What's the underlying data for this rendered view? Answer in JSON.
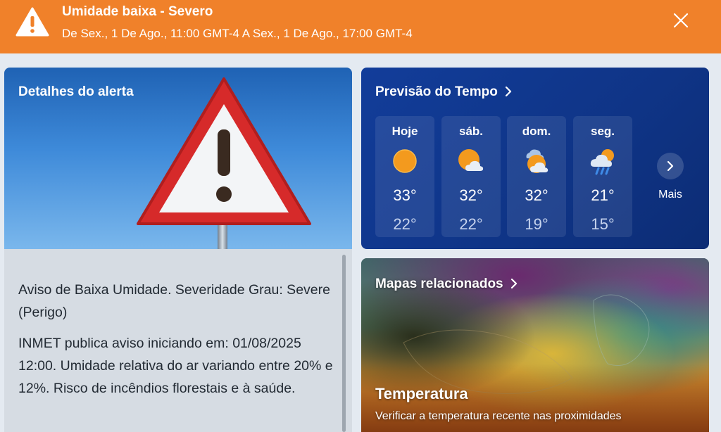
{
  "banner": {
    "title": "Umidade baixa - Severo",
    "period": "De Sex., 1 De Ago., 11:00 GMT-4 A Sex., 1 De Ago., 17:00 GMT-4",
    "icon": "warning-triangle-icon",
    "close_icon": "close-icon",
    "color": "#f0812a"
  },
  "details": {
    "title": "Detalhes do alerta",
    "paragraphs": [
      "Aviso de Baixa Umidade. Severidade Grau: Severe (Perigo)",
      "INMET publica aviso iniciando em: 01/08/2025 12:00. Umidade relativa do ar variando entre 20% e 12%. Risco de incêndios florestais e à saúde."
    ]
  },
  "forecast": {
    "title": "Previsão do Tempo",
    "days": [
      {
        "name": "Hoje",
        "icon": "sunny-icon",
        "high": "33°",
        "low": "22°"
      },
      {
        "name": "sáb.",
        "icon": "partly-sunny-icon",
        "high": "32°",
        "low": "22°"
      },
      {
        "name": "dom.",
        "icon": "mostly-cloudy-icon",
        "high": "32°",
        "low": "19°"
      },
      {
        "name": "seg.",
        "icon": "rain-showers-icon",
        "high": "21°",
        "low": "15°"
      }
    ],
    "more_label": "Mais",
    "more_icon": "chevron-right-icon"
  },
  "maps": {
    "title": "Mapas relacionados",
    "layer_title": "Temperatura",
    "layer_subtitle": "Verificar a temperatura recente nas proximidades"
  }
}
